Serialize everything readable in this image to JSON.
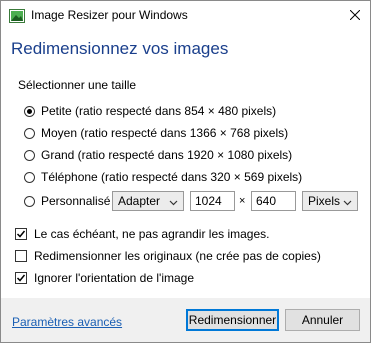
{
  "window": {
    "title": "Image Resizer pour Windows"
  },
  "heading": "Redimensionnez vos images",
  "size_section_label": "Sélectionner une taille",
  "sizes": [
    {
      "label": "Petite (ratio respecté dans 854 × 480 pixels)",
      "checked": true
    },
    {
      "label": "Moyen (ratio respecté dans 1366 × 768 pixels)",
      "checked": false
    },
    {
      "label": "Grand (ratio respecté dans 1920 × 1080 pixels)",
      "checked": false
    },
    {
      "label": "Téléphone (ratio respecté dans 320 × 569 pixels)",
      "checked": false
    }
  ],
  "custom": {
    "label": "Personnalisé",
    "mode": "Adapter",
    "width": "1024",
    "times": "×",
    "height": "640",
    "unit": "Pixels"
  },
  "options": {
    "no_enlarge": "Le cas échéant, ne pas agrandir les images.",
    "resize_originals": "Redimensionner les originaux (ne crée pas de copies)",
    "ignore_orientation": "Ignorer l'orientation de l'image"
  },
  "footer": {
    "advanced_link": "Paramètres avancés",
    "resize_button": "Redimensionner",
    "cancel_button": "Annuler"
  },
  "colors": {
    "heading": "#1a3f8c",
    "link": "#1a5fb4",
    "focus_border": "#0078d7"
  }
}
